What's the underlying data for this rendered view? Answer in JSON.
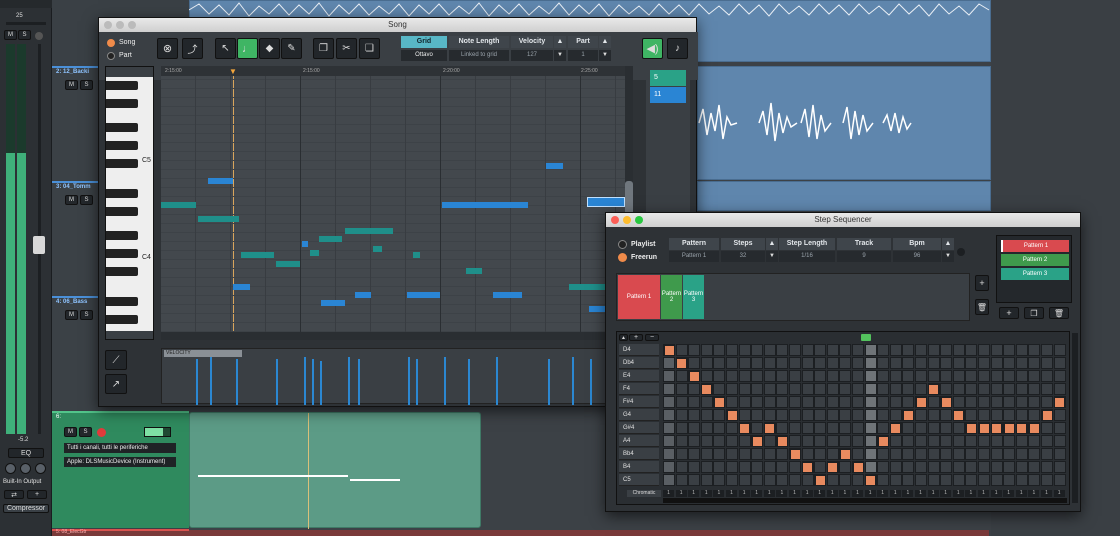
{
  "mixer": {
    "top_value": "25",
    "eq_label": "EQ",
    "bottom_value": "-5.2",
    "output_label": "Built-In Output",
    "fx_label": "Compressor",
    "meter_level": 0.72
  },
  "tracks": [
    {
      "name": "2: 12_Backi"
    },
    {
      "name": "3: 04_Tomm"
    },
    {
      "name": "4: 06_Bass"
    },
    {
      "name": "5: 08_ElecGtr"
    }
  ],
  "midi_track": {
    "name": "6:",
    "input": "Tutti i canali, tutti le periferiche",
    "instrument": "Apple: DLSMusicDevice (Instrument)"
  },
  "track_buttons": {
    "mute": "M",
    "solo": "S"
  },
  "piano_roll": {
    "title": "Song",
    "mode_song": "Song",
    "mode_part": "Part",
    "columns": [
      "Grid",
      "Note Length",
      "Velocity",
      "Part"
    ],
    "values": [
      "Ottavo",
      "Linked to grid",
      "127",
      "1"
    ],
    "timeline": [
      "2:15:00",
      "2:15:00",
      "2:20:00",
      "2:25:00"
    ],
    "key_labels": [
      "C5",
      "C4"
    ],
    "velocity_label": "VELOCITY",
    "part_numbers": [
      "5",
      "11"
    ]
  },
  "step_sequencer": {
    "title": "Step Sequencer",
    "modes": [
      "Playlist",
      "Freerun"
    ],
    "columns": [
      "Pattern",
      "Steps",
      "Step Length",
      "Track",
      "Bpm"
    ],
    "values": [
      "Pattern 1",
      "32",
      "1/16",
      "9",
      "96"
    ],
    "pattern_list": [
      {
        "name": "Pattern 1",
        "color": "#d94a4f"
      },
      {
        "name": "Pattern 2",
        "color": "#3f9a4c"
      },
      {
        "name": "Pattern 3",
        "color": "#2aa287"
      }
    ],
    "lane_patterns": [
      "Pattern 1",
      "Pattern 2",
      "Pattern 3"
    ],
    "notes": [
      "D4",
      "Db4",
      "E4",
      "F4",
      "F#4",
      "G4",
      "G#4",
      "A4",
      "Bb4",
      "B4",
      "C5"
    ],
    "steps": [
      0,
      1,
      2,
      3,
      4,
      5,
      6,
      7,
      6,
      7,
      8,
      9,
      10,
      9,
      8,
      9,
      10,
      7,
      6,
      5,
      4,
      3,
      4,
      5,
      6,
      6,
      6,
      6,
      6,
      6,
      5,
      4
    ],
    "chromatic_label": "Chromatic",
    "step_values": "1"
  }
}
